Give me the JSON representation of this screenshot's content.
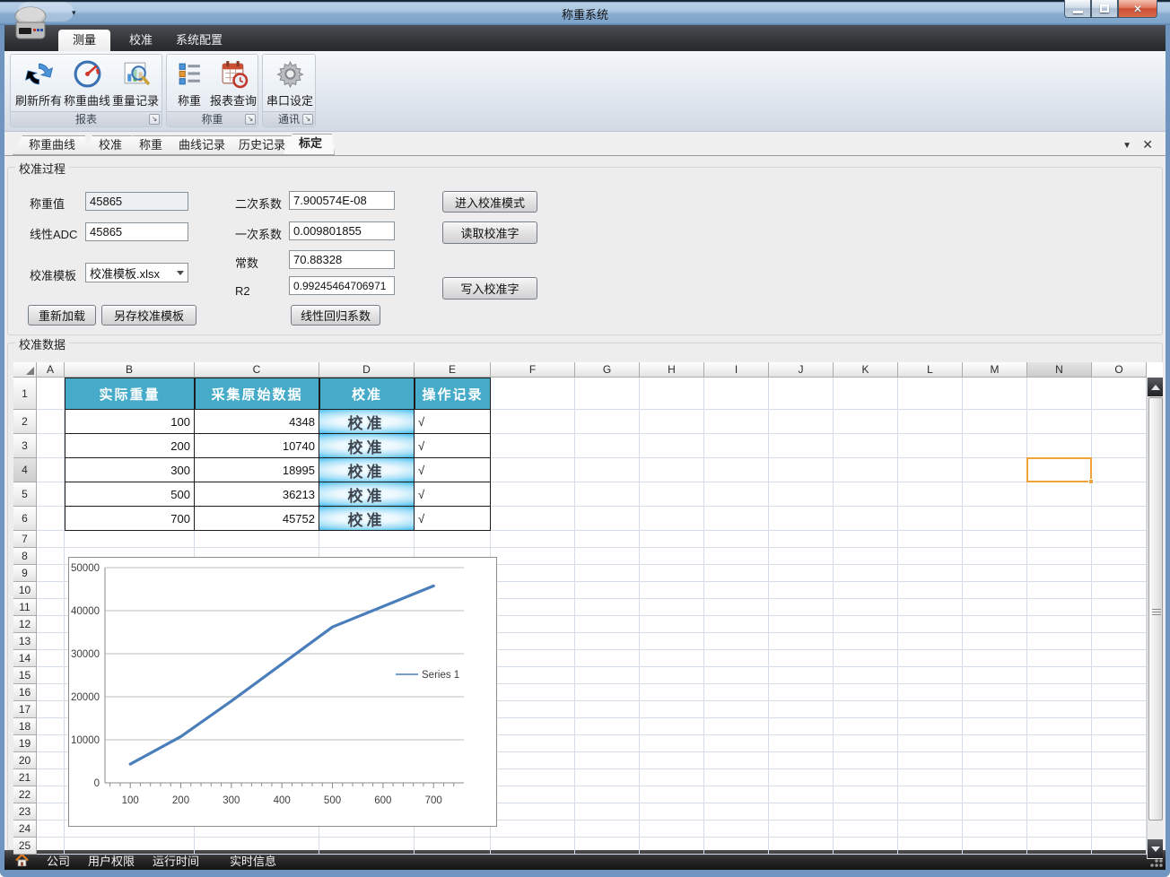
{
  "window": {
    "title": "称重系统"
  },
  "titlebar": {
    "controls": {
      "minimize": "minimize",
      "maximize": "maximize",
      "close": "close"
    }
  },
  "ribbon": {
    "tabs": [
      {
        "label": "测量",
        "active": true
      },
      {
        "label": "校准",
        "active": false
      },
      {
        "label": "系统配置",
        "active": false
      }
    ],
    "groups": [
      {
        "label": "报表",
        "buttons": [
          {
            "label": "刷新所有",
            "icon": "refresh-icon"
          },
          {
            "label": "称重曲线",
            "icon": "gauge-icon"
          },
          {
            "label": "重量记录",
            "icon": "chart-search-icon"
          }
        ]
      },
      {
        "label": "称重",
        "buttons": [
          {
            "label": "称重",
            "icon": "list-icon"
          },
          {
            "label": "报表查询",
            "icon": "calendar-clock-icon"
          }
        ]
      },
      {
        "label": "通讯",
        "buttons": [
          {
            "label": "串口设定",
            "icon": "gear-icon"
          }
        ]
      }
    ]
  },
  "doc_tabs": {
    "items": [
      {
        "label": "称重曲线",
        "active": false
      },
      {
        "label": "校准",
        "active": false
      },
      {
        "label": "称重",
        "active": false
      },
      {
        "label": "曲线记录",
        "active": false
      },
      {
        "label": "历史记录",
        "active": false
      },
      {
        "label": "标定",
        "active": true
      }
    ]
  },
  "calibration_process": {
    "title": "校准过程",
    "fields": {
      "weight_label": "称重值",
      "weight_value": "45865",
      "adc_label": "线性ADC",
      "adc_value": "45865",
      "template_label": "校准模板",
      "template_value": "校准模板.xlsx",
      "quad_label": "二次系数",
      "quad_value": "7.900574E-08",
      "linear_label": "一次系数",
      "linear_value": "0.009801855",
      "const_label": "常数",
      "const_value": "70.88328",
      "r2_label": "R2",
      "r2_value": "0.99245464706971"
    },
    "buttons": {
      "reload": "重新加载",
      "save_as": "另存校准模板",
      "regression": "线性回归系数",
      "enter_mode": "进入校准模式",
      "read_word": "读取校准字",
      "write_word": "写入校准字"
    }
  },
  "calibration_data": {
    "title": "校准数据",
    "grid": {
      "columns": [
        "A",
        "B",
        "C",
        "D",
        "E",
        "F",
        "G",
        "H",
        "I",
        "J",
        "K",
        "L",
        "M",
        "N",
        "O"
      ],
      "row_count": 25,
      "header_row": [
        "实际重量",
        "采集原始数据",
        "校准",
        "操作记录"
      ],
      "rows": [
        {
          "weight": "100",
          "raw": "4348",
          "action": "校准",
          "record": "√"
        },
        {
          "weight": "200",
          "raw": "10740",
          "action": "校准",
          "record": "√"
        },
        {
          "weight": "300",
          "raw": "18995",
          "action": "校准",
          "record": "√"
        },
        {
          "weight": "500",
          "raw": "36213",
          "action": "校准",
          "record": "√"
        },
        {
          "weight": "700",
          "raw": "45752",
          "action": "校准",
          "record": "√"
        }
      ],
      "selected_cell": "N4",
      "header_color": "#45abc8",
      "selection_color": "#f0a33a"
    }
  },
  "chart_data": {
    "type": "line",
    "x": [
      100,
      200,
      300,
      500,
      700
    ],
    "series": [
      {
        "name": "Series 1",
        "values": [
          4348,
          10740,
          18995,
          36213,
          45752
        ]
      }
    ],
    "title": "",
    "xlabel": "",
    "ylabel": "",
    "xlim": [
      50,
      760
    ],
    "ylim": [
      0,
      50000
    ],
    "xticks": [
      100,
      200,
      300,
      400,
      500,
      600,
      700
    ],
    "yticks": [
      0,
      10000,
      20000,
      30000,
      40000,
      50000
    ],
    "minor_tick_step": 20,
    "grid": "horizontal",
    "legend_position": "right-middle",
    "line_color": "#4a7ebb"
  },
  "statusbar": {
    "items": [
      "公司",
      "用户权限",
      "运行时间",
      "实时信息"
    ]
  }
}
